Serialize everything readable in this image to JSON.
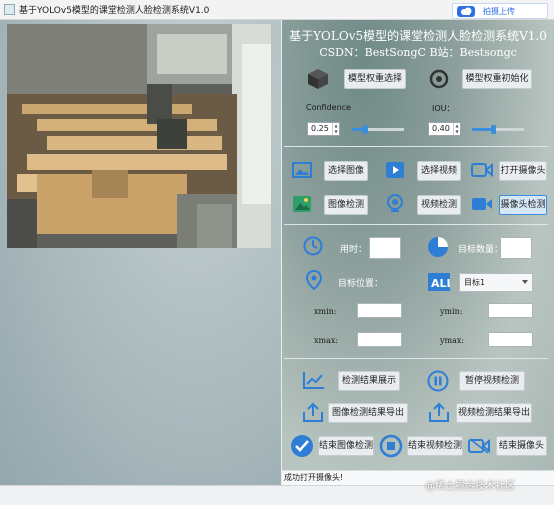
{
  "window": {
    "title": "基于YOLOv5模型的课堂检测人脸检测系统V1.0"
  },
  "upload": {
    "label": "拍摄上传"
  },
  "header": {
    "title": "基于YOLOv5模型的课堂检测人脸检测系统V1.0",
    "subtitle": "CSDN：BestSongC   B站：Bestsongc"
  },
  "model": {
    "select_label": "模型权重选择",
    "init_label": "模型权重初始化"
  },
  "params": {
    "confidence_label": "Confidence",
    "iou_label": "IOU：",
    "confidence_value": "0.25",
    "iou_value": "0.40",
    "confidence_level": 0.25,
    "iou_level": 0.4
  },
  "buttons": {
    "select_image": "选择图像",
    "select_video": "选择视频",
    "open_camera": "打开摄像头",
    "image_detect": "图像检测",
    "video_detect": "视频检测",
    "camera_detect": "摄像头检测",
    "show_result": "检测结果展示",
    "pause_video": "暂停视频检测",
    "export_image_result": "图像检测结果导出",
    "export_video_result": "视频检测结果导出",
    "end_image": "结束图像检测",
    "end_video": "结束视频检测",
    "end_camera": "结束摄像头"
  },
  "info": {
    "time_label": "用时：",
    "count_label": "目标数量：",
    "position_label": "目标位置：",
    "target_value": "目标1",
    "xmin_label": "xmin:",
    "ymin_label": "ymin:",
    "xmax_label": "xmax:",
    "ymax_label": "ymax:"
  },
  "status": {
    "text": "成功打开摄像头!"
  },
  "watermark": {
    "text": "@稀土掘金技术社区"
  },
  "colors": {
    "accent": "#3b8edb",
    "icon_blue": "#2e7ed6"
  }
}
